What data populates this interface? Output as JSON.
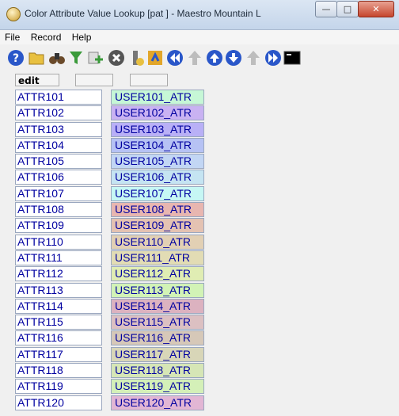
{
  "window": {
    "title": "Color Attribute Value Lookup [pat    ] - Maestro Mountain L"
  },
  "menu": [
    "File",
    "Record",
    "Help"
  ],
  "toolbar": [
    {
      "name": "help-icon",
      "color": "#2a57c9"
    },
    {
      "name": "folder-open-icon",
      "color": "#e8c040"
    },
    {
      "name": "binoculars-icon",
      "color": "#6a4a2a"
    },
    {
      "name": "filter-icon",
      "color": "#3a9a3a"
    },
    {
      "name": "add-record-icon",
      "color": "#3a9a3a"
    },
    {
      "name": "delete-record-icon",
      "color": "#555555"
    },
    {
      "name": "info-icon",
      "color": "#777777"
    },
    {
      "name": "refresh-icon",
      "color": "#e2a62a"
    },
    {
      "name": "first-record-icon",
      "color": "#2a57c9"
    },
    {
      "name": "previous-disabled-icon",
      "color": "#bdbdbd"
    },
    {
      "name": "up-record-icon",
      "color": "#2a57c9"
    },
    {
      "name": "down-record-icon",
      "color": "#2a57c9"
    },
    {
      "name": "next-disabled-icon",
      "color": "#bdbdbd"
    },
    {
      "name": "last-record-icon",
      "color": "#2a57c9"
    },
    {
      "name": "terminal-icon",
      "color": "#000000"
    }
  ],
  "edit_row": {
    "mode": "edit",
    "field2": "",
    "field3": ""
  },
  "rows": [
    {
      "attr": "ATTR101",
      "user": "USER101_ATR",
      "color": "#c6f7d6"
    },
    {
      "attr": "ATTR102",
      "user": "USER102_ATR",
      "color": "#c9b2f2"
    },
    {
      "attr": "ATTR103",
      "user": "USER103_ATR",
      "color": "#b9b0f6"
    },
    {
      "attr": "ATTR104",
      "user": "USER104_ATR",
      "color": "#b6c2f4"
    },
    {
      "attr": "ATTR105",
      "user": "USER105_ATR",
      "color": "#c2d6f4"
    },
    {
      "attr": "ATTR106",
      "user": "USER106_ATR",
      "color": "#c5e4f2"
    },
    {
      "attr": "ATTR107",
      "user": "USER107_ATR",
      "color": "#c6f7f4"
    },
    {
      "attr": "ATTR108",
      "user": "USER108_ATR",
      "color": "#e8b6b0"
    },
    {
      "attr": "ATTR109",
      "user": "USER109_ATR",
      "color": "#e4c2b2"
    },
    {
      "attr": "ATTR110",
      "user": "USER110_ATR",
      "color": "#e2d0b4"
    },
    {
      "attr": "ATTR111",
      "user": "USER111_ATR",
      "color": "#e2dcb4"
    },
    {
      "attr": "ATTR112",
      "user": "USER112_ATR",
      "color": "#e0edb3"
    },
    {
      "attr": "ATTR113",
      "user": "USER113_ATR",
      "color": "#d2f3b6"
    },
    {
      "attr": "ATTR114",
      "user": "USER114_ATR",
      "color": "#dcb2c0"
    },
    {
      "attr": "ATTR115",
      "user": "USER115_ATR",
      "color": "#dcc0c2"
    },
    {
      "attr": "ATTR116",
      "user": "USER116_ATR",
      "color": "#d6c8b8"
    },
    {
      "attr": "ATTR117",
      "user": "USER117_ATR",
      "color": "#d8d6b8"
    },
    {
      "attr": "ATTR118",
      "user": "USER118_ATR",
      "color": "#d6e6b6"
    },
    {
      "attr": "ATTR119",
      "user": "USER119_ATR",
      "color": "#d4f0b8"
    },
    {
      "attr": "ATTR120",
      "user": "USER120_ATR",
      "color": "#e2b6d4"
    }
  ]
}
